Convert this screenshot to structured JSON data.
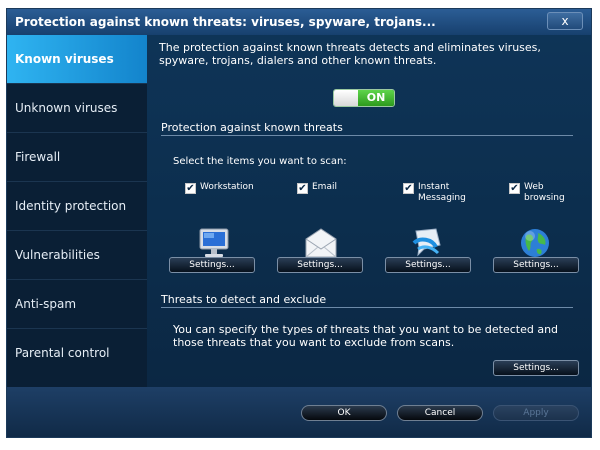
{
  "window": {
    "title": "Protection against known threats: viruses, spyware, trojans...",
    "close_label": "x"
  },
  "sidebar": {
    "items": [
      {
        "label": "Known viruses",
        "active": true
      },
      {
        "label": "Unknown viruses"
      },
      {
        "label": "Firewall"
      },
      {
        "label": "Identity protection"
      },
      {
        "label": "Vulnerabilities"
      },
      {
        "label": "Anti-spam"
      },
      {
        "label": "Parental control"
      }
    ]
  },
  "main": {
    "description": "The protection against known threats detects and eliminates viruses, spyware, trojans, dialers and other known threats.",
    "toggle": {
      "state_label": "ON"
    },
    "section1": {
      "title": "Protection against known threats",
      "prompt": "Select the items you want to scan:",
      "items": [
        {
          "label": "Workstation",
          "checked": true,
          "icon": "monitor-icon",
          "settings_label": "Settings..."
        },
        {
          "label": "Email",
          "checked": true,
          "icon": "envelope-icon",
          "settings_label": "Settings..."
        },
        {
          "label": "Instant Messaging",
          "checked": true,
          "icon": "chat-bubble-icon",
          "settings_label": "Settings..."
        },
        {
          "label": "Web browsing",
          "checked": true,
          "icon": "globe-icon",
          "settings_label": "Settings..."
        }
      ]
    },
    "section2": {
      "title": "Threats to detect and exclude",
      "description": "You can specify the types of threats that you want to be detected and those threats that you want to exclude from scans.",
      "settings_label": "Settings..."
    }
  },
  "footer": {
    "ok_label": "OK",
    "cancel_label": "Cancel",
    "apply_label": "Apply"
  },
  "colors": {
    "accent": "#1a9be0",
    "toggle_on": "#3bb22a",
    "background": "#0c2d4c"
  }
}
